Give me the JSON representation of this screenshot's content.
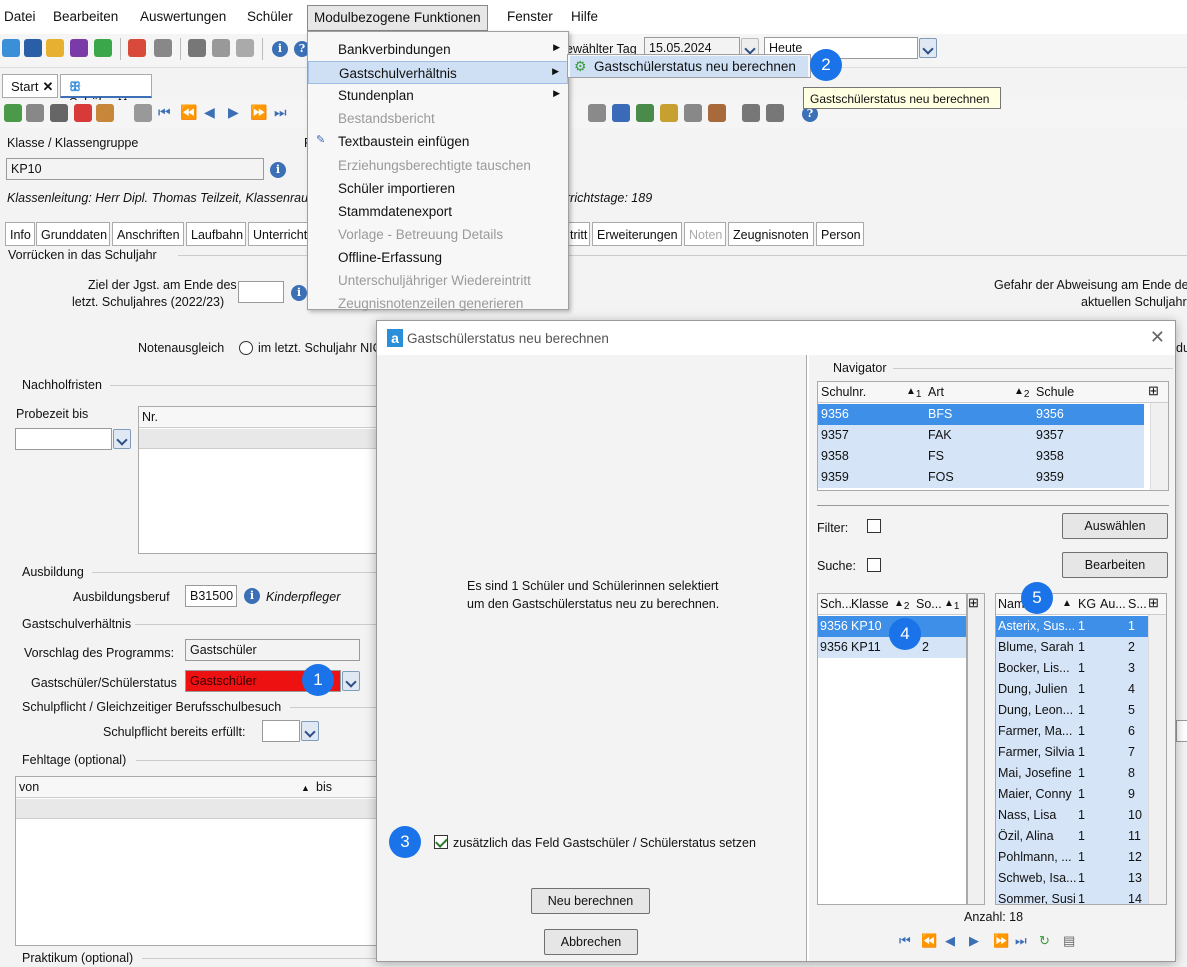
{
  "menubar": [
    "Datei",
    "Bearbeiten",
    "Auswertungen",
    "Schüler",
    "Modulbezogene Funktionen",
    "Fenster",
    "Hilfe"
  ],
  "toolbar": {
    "day_label": "ewählter Tag",
    "day_value": "15.05.2024",
    "heute_value": "Heute"
  },
  "doc_tabs": {
    "start": "Start",
    "schueler": "Schüler",
    "close": "✕"
  },
  "klasse": {
    "label": "Klasse / Klassengruppe",
    "value": "KP10",
    "right_label": "F"
  },
  "klassenleitung": "Klassenleitung: Herr Dipl. Thomas Teilzeit, Klassenrau",
  "unterrichtstage": "rrichtstage: 189",
  "page_tabs": [
    "Info",
    "Grunddaten",
    "Anschriften",
    "Laufbahn",
    "Unterricht",
    "tritt",
    "Erweiterungen",
    "Noten",
    "Zeugnisnoten",
    "Person"
  ],
  "sections": {
    "vorruecken": "Vorrücken in das Schuljahr",
    "ziel_line1": "Ziel der Jgst. am Ende des",
    "ziel_line2": "letzt. Schuljahres (2022/23)",
    "gefahr_line1": "Gefahr der Abweisung am Ende de",
    "gefahr_line2": "aktuellen Schuljahre",
    "notenausgleich": "Notenausgleich",
    "notenausgleich_option": "im letzt. Schuljahr NIC",
    "right_du": "du",
    "nachholfristen": "Nachholfristen",
    "probezeit": "Probezeit bis",
    "nr": "Nr.",
    "ausbildung": "Ausbildung",
    "ausbildungsberuf": "Ausbildungsberuf",
    "ausbildungsberuf_code": "B31500",
    "ausbildungsberuf_name": "Kinderpfleger",
    "gastschul": "Gastschulverhältnis",
    "vorschlag": "Vorschlag des Programms:",
    "vorschlag_value": "Gastschüler",
    "status_label": "Gastschüler/Schülerstatus",
    "status_value": "Gastschüler",
    "schulpflicht": "Schulpflicht / Gleichzeitiger Berufsschulbesuch",
    "schulpflicht_label": "Schulpflicht bereits erfüllt:",
    "fehltage": "Fehltage (optional)",
    "von": "von",
    "bis": "bis",
    "praktikum": "Praktikum (optional)"
  },
  "menu": {
    "items": [
      {
        "label": "Bankverbindungen",
        "enabled": true,
        "submenu": true
      },
      {
        "label": "Gastschulverhältnis",
        "enabled": true,
        "submenu": true,
        "highlight": true
      },
      {
        "label": "Stundenplan",
        "enabled": true,
        "submenu": true
      },
      {
        "label": "Bestandsbericht",
        "enabled": false
      },
      {
        "label": "Textbaustein einfügen",
        "enabled": true
      },
      {
        "label": "Erziehungsberechtigte tauschen",
        "enabled": false
      },
      {
        "label": "Schüler importieren",
        "enabled": true
      },
      {
        "label": "Stammdatenexport",
        "enabled": true
      },
      {
        "label": "Vorlage - Betreuung Details",
        "enabled": false
      },
      {
        "label": "Offline-Erfassung",
        "enabled": true
      },
      {
        "label": "Unterschuljähriger Wiedereintritt",
        "enabled": false
      },
      {
        "label": "Zeugnisnotenzeilen generieren",
        "enabled": false
      }
    ],
    "submenu_item": "Gastschülerstatus neu berechnen",
    "tooltip": "Gastschülerstatus neu berechnen"
  },
  "badges": [
    "1",
    "2",
    "3",
    "4",
    "5"
  ],
  "dialog": {
    "title": "Gastschülerstatus neu berechnen",
    "logo": "a",
    "close": "✕",
    "message_line1": "Es sind 1 Schüler und Schülerinnen selektiert",
    "message_line2": "um den Gastschülerstatus neu zu berechnen.",
    "checkbox_label": "zusätzlich das Feld Gastschüler / Schülerstatus setzen",
    "btn_neu": "Neu berechnen",
    "btn_abbrechen": "Abbrechen",
    "navigator": {
      "title": "Navigator",
      "headers": [
        "Schulnr.",
        "1",
        "Art",
        "2",
        "Schule"
      ],
      "rows": [
        [
          "9356",
          "BFS",
          "9356"
        ],
        [
          "9357",
          "FAK",
          "9357"
        ],
        [
          "9358",
          "FS",
          "9358"
        ],
        [
          "9359",
          "FOS",
          "9359"
        ]
      ],
      "filter": "Filter:",
      "suche": "Suche:",
      "btn_auswaehlen": "Auswählen",
      "btn_bearbeiten": "Bearbeiten"
    },
    "klassen": {
      "headers": [
        "Sch...",
        "Klasse",
        "2",
        "So...",
        "1"
      ],
      "rows": [
        [
          "9356",
          "KP10",
          "",
          ""
        ],
        [
          "9356",
          "KP11",
          "",
          "2"
        ]
      ]
    },
    "schueler": {
      "headers": [
        "Nam",
        "KG",
        "Au...",
        "S..."
      ],
      "rows": [
        [
          "Asterix, Sus...",
          "1",
          "",
          "1"
        ],
        [
          "Blume, Sarah",
          "1",
          "",
          "2"
        ],
        [
          "Bocker, Lis...",
          "1",
          "",
          "3"
        ],
        [
          "Dung, Julien",
          "1",
          "",
          "4"
        ],
        [
          "Dung, Leon...",
          "1",
          "",
          "5"
        ],
        [
          "Farmer, Ma...",
          "1",
          "",
          "6"
        ],
        [
          "Farmer, Silvia",
          "1",
          "",
          "7"
        ],
        [
          "Mai, Josefine",
          "1",
          "",
          "8"
        ],
        [
          "Maier, Conny",
          "1",
          "",
          "9"
        ],
        [
          "Nass, Lisa",
          "1",
          "",
          "10"
        ],
        [
          "Özil, Alina",
          "1",
          "",
          "11"
        ],
        [
          "Pohlmann, ...",
          "1",
          "",
          "12"
        ],
        [
          "Schweb, Isa...",
          "1",
          "",
          "13"
        ],
        [
          "Sommer, Susi",
          "1",
          "",
          "14"
        ]
      ],
      "anzahl": "Anzahl: 18"
    },
    "nav_icons": [
      "⏮",
      "⏪",
      "◀",
      "▶",
      "⏩",
      "⏭",
      "↻",
      "▤"
    ]
  },
  "colors": {
    "status_red": "#ee1111",
    "selected": "#3d8fe8",
    "badge": "#1a73e8"
  }
}
